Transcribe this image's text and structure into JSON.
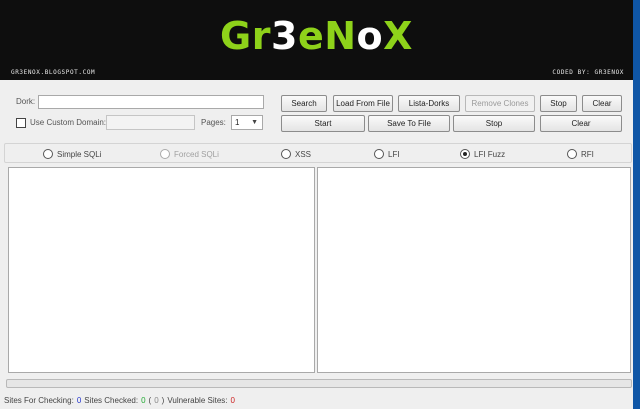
{
  "banner": {
    "logo_parts": [
      "Gr",
      "3",
      "eN",
      "o",
      "X"
    ],
    "blog": "Gr3enoX.blogspot.com",
    "coded_by": "Coded By: Gr3enoX"
  },
  "form": {
    "dork_label": "Dork:",
    "dork_value": "",
    "custom_domain_label": "Use Custom Domain:",
    "custom_domain_checked": false,
    "custom_domain_value": "",
    "pages_label": "Pages:",
    "pages_value": "1"
  },
  "buttons": {
    "search": "Search",
    "load_from_file": "Load From File",
    "lista_dorks": "Lista-Dorks",
    "remove_clones": "Remove Clones",
    "stop_top": "Stop",
    "clear_top": "Clear",
    "start": "Start",
    "save_to_file": "Save To File",
    "stop_bottom": "Stop",
    "clear_bottom": "Clear"
  },
  "modes": [
    {
      "label": "Simple SQLi",
      "checked": false,
      "disabled": false
    },
    {
      "label": "Forced SQLi",
      "checked": false,
      "disabled": true
    },
    {
      "label": "XSS",
      "checked": false,
      "disabled": false
    },
    {
      "label": "LFI",
      "checked": false,
      "disabled": false
    },
    {
      "label": "LFI Fuzz",
      "checked": true,
      "disabled": false
    },
    {
      "label": "RFI",
      "checked": false,
      "disabled": false
    }
  ],
  "progress": 0,
  "status": {
    "sites_for_checking_label": "Sites For Checking:",
    "sites_for_checking": "0",
    "sites_checked_label": "Sites Checked:",
    "sites_checked": "0",
    "paren_open": "(",
    "sites_checked_extra": "0",
    "paren_close": ")",
    "vulnerable_label": "Vulnerable Sites:",
    "vulnerable": "0"
  },
  "colors": {
    "banner_bg": "#0e0e0e",
    "logo_green": "#8ed21a",
    "accent_strip": "#0f56a6"
  }
}
